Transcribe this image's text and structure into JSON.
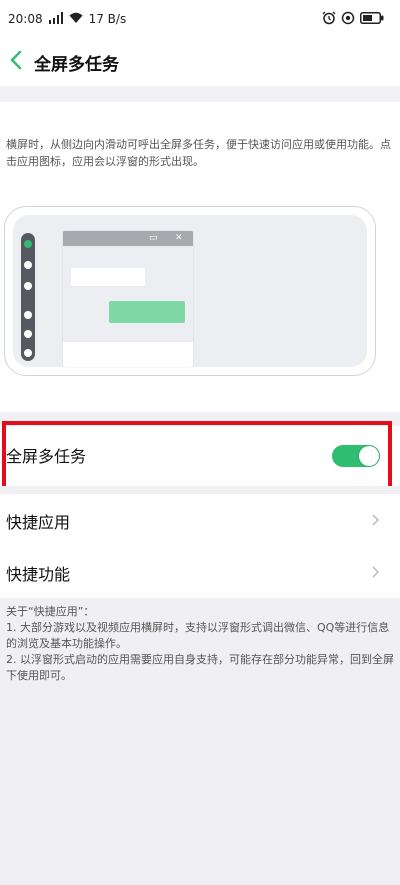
{
  "status_bar": {
    "time": "20:08",
    "net_speed": "17 B/s"
  },
  "nav": {
    "title": "全屏多任务"
  },
  "description": "横屏时，从侧边向内滑动可呼出全屏多任务，便于快速访问应用或使用功能。点击应用图标，应用会以浮窗的形式出现。",
  "toggle_row": {
    "label": "全屏多任务",
    "enabled": true
  },
  "list": [
    {
      "label": "快捷应用"
    },
    {
      "label": "快捷功能"
    }
  ],
  "footer": {
    "heading": "关于“快捷应用”：",
    "line1": "1. 大部分游戏以及视频应用横屏时，支持以浮窗形式调出微信、QQ等进行信息的浏览及基本功能操作。",
    "line2": "2. 以浮窗形式启动的应用需要应用自身支持，可能存在部分功能异常，回到全屏下使用即可。"
  },
  "colors": {
    "accent_green": "#2fbd72",
    "highlight_red": "#e10d1a"
  },
  "icons": {
    "back": "chevron-left",
    "chevron": "chevron-right",
    "wifi": "wifi",
    "battery": "battery"
  }
}
